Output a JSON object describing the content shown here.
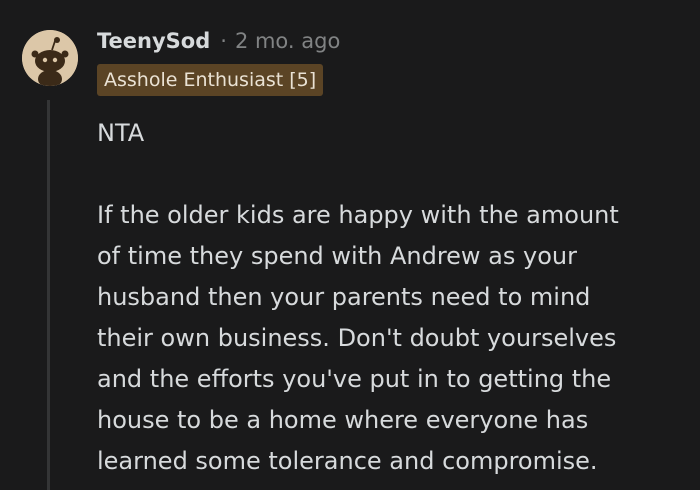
{
  "comment": {
    "author": "TeenySod",
    "separator": "·",
    "timestamp": "2 mo. ago",
    "flair": "Asshole Enthusiast [5]",
    "icons": {
      "avatar": "snoo-avatar-icon"
    },
    "colors": {
      "background": "#1a1a1b",
      "text": "#d7dadc",
      "meta": "#818384",
      "flair_bg": "#5b4425",
      "avatar_bg": "#dcc7a8"
    },
    "paragraphs": [
      {
        "lines": [
          "NTA"
        ]
      },
      {
        "lines": [
          "If the older kids are happy with the amount",
          "of time they spend with Andrew as your",
          "husband then your parents need to mind",
          "their own business. Don't doubt yourselves",
          "and the efforts you've put in to getting the",
          "house to be a home where everyone has",
          "learned some tolerance and compromise."
        ]
      }
    ]
  }
}
